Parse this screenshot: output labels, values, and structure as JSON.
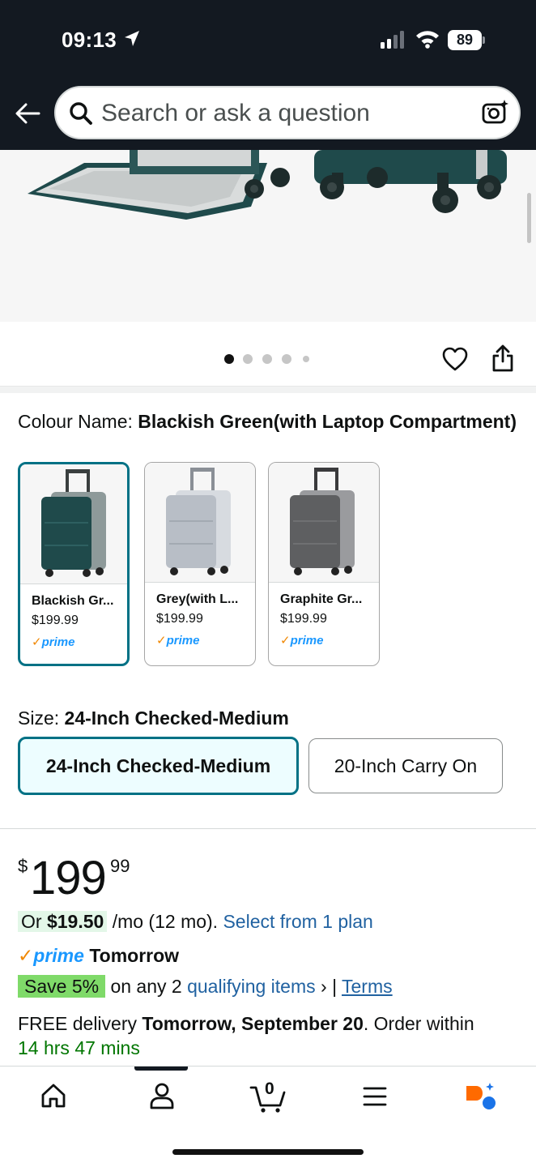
{
  "status_bar": {
    "time": "09:13",
    "battery": "89"
  },
  "search": {
    "placeholder": "Search or ask a question"
  },
  "gallery": {
    "dot_count": 5,
    "active_index": 0
  },
  "colour": {
    "label": "Colour Name: ",
    "selected": "Blackish Green(with Laptop Compartment)",
    "options": [
      {
        "name": "Blackish Gr...",
        "price": "$199.99",
        "prime": "prime",
        "color": "#1f4a4b"
      },
      {
        "name": "Grey(with L...",
        "price": "$199.99",
        "prime": "prime",
        "color": "#b8bec6"
      },
      {
        "name": "Graphite Gr...",
        "price": "$199.99",
        "prime": "prime",
        "color": "#5e5f61"
      }
    ]
  },
  "size": {
    "label": "Size: ",
    "selected": "24-Inch Checked-Medium",
    "options": [
      "24-Inch Checked-Medium",
      "20-Inch Carry On"
    ]
  },
  "price": {
    "currency": "$",
    "whole": "199",
    "fraction": "99"
  },
  "installment": {
    "prefix": "Or ",
    "amount": "$19.50",
    "term": " /mo (12 mo). ",
    "link": "Select from 1 plan"
  },
  "prime_delivery": {
    "logo": "prime",
    "text": "Tomorrow"
  },
  "promo": {
    "badge": "Save 5%",
    "text": " on any 2 ",
    "link": "qualifying items",
    "separator": " › | ",
    "terms": "Terms"
  },
  "delivery": {
    "prefix": "FREE delivery ",
    "date": "Tomorrow, September 20",
    "middle": ". Order within ",
    "countdown": "14 hrs 47 mins"
  },
  "colors": {
    "brand_dark": "#131921",
    "accent_teal": "#007185",
    "link": "#2162a1",
    "prime_blue": "#1a98ff",
    "prime_orange": "#f08804"
  },
  "bottom_nav": [
    "home-icon",
    "account-icon",
    "cart-icon",
    "menu-icon",
    "rufus-icon"
  ],
  "cart_count": "0"
}
